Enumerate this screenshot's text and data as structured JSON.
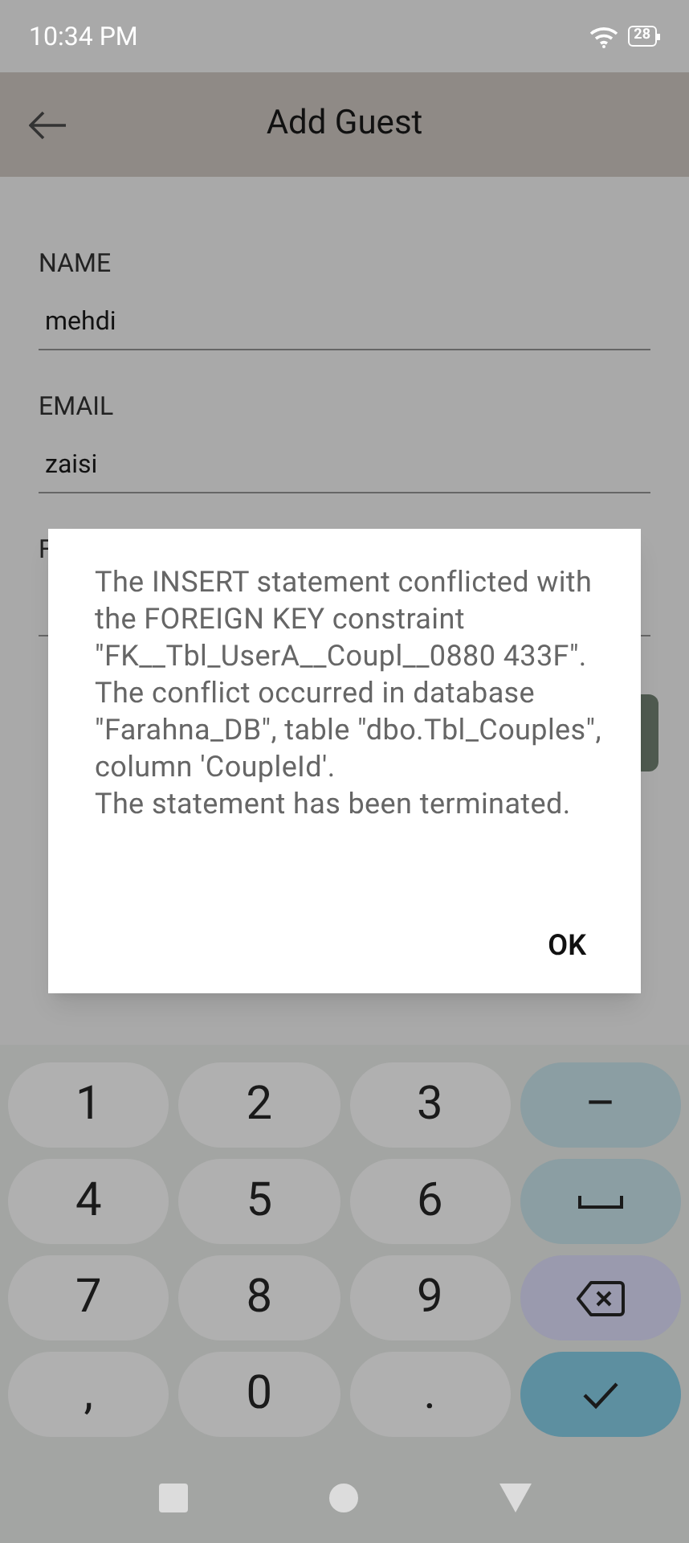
{
  "status_bar": {
    "time": "10:34 PM",
    "battery": "28"
  },
  "app_bar": {
    "title": "Add Guest"
  },
  "fields": [
    {
      "label": "NAME",
      "value": "mehdi"
    },
    {
      "label": "EMAIL",
      "value": "zaisi"
    },
    {
      "label": "F"
    }
  ],
  "dialog": {
    "message": "The INSERT statement conflicted with the FOREIGN KEY constraint \"FK__Tbl_UserA__Coupl__0880 433F\". The conflict occurred in database \"Farahna_DB\", table \"dbo.Tbl_Couples\", column 'CoupleId'.\nThe statement has been terminated.",
    "button": "OK"
  },
  "keyboard": [
    {
      "kind": "char",
      "label": "1"
    },
    {
      "kind": "char",
      "label": "2"
    },
    {
      "kind": "char",
      "label": "3"
    },
    {
      "kind": "function",
      "label": "–"
    },
    {
      "kind": "char",
      "label": "4"
    },
    {
      "kind": "char",
      "label": "5"
    },
    {
      "kind": "char",
      "label": "6"
    },
    {
      "kind": "space"
    },
    {
      "kind": "char",
      "label": "7"
    },
    {
      "kind": "char",
      "label": "8"
    },
    {
      "kind": "char",
      "label": "9"
    },
    {
      "kind": "delete"
    },
    {
      "kind": "char",
      "label": ","
    },
    {
      "kind": "char",
      "label": "0"
    },
    {
      "kind": "char",
      "label": "."
    },
    {
      "kind": "enter"
    }
  ]
}
